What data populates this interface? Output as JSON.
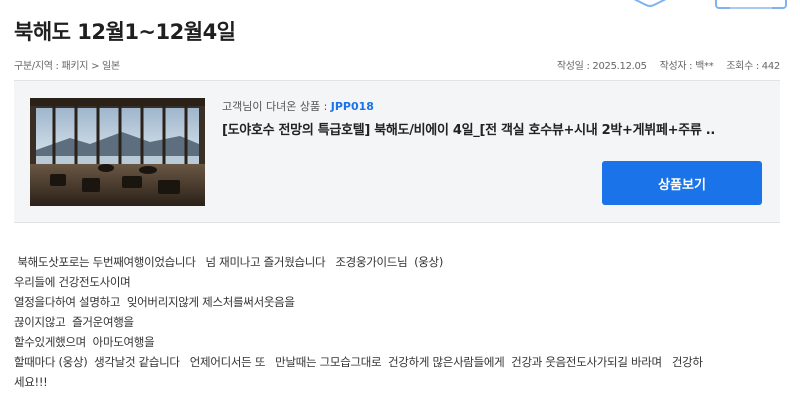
{
  "page": {
    "title": "북해도 12월1~12월4일",
    "breadcrumb": "구분/지역 : 패키지 > 일본",
    "meta": {
      "date": "작성일 : 2025.12.05",
      "author": "작성자 : 백**",
      "views": "조회수 : 442"
    }
  },
  "product": {
    "prefix": "고객님이 다녀온 상품 : ",
    "code": "JPP018",
    "name": "[도야호수 전망의 특급호텔] 북해도/비에이 4일_[전 객실 호수뷰+시내 2박+게뷔페+주류 ..",
    "button_label": "상품보기",
    "thumbnail_icon": "hotel-lake-photo"
  },
  "review": {
    "lines": [
      " 북해도삿포로는 두번째여행이었습니다   넘 재미나고 즐거웠습니다   조경웅가이드님  (웅상)",
      "우리들에 건강전도사이며",
      "열정을다하여 설명하고  잊어버리지않게 제스처를써서웃음을",
      "끊이지않고  즐거운여행을",
      "할수있게했으며  아마도여행을",
      "할때마다 (웅상)  생각날것 같습니다   언제어디서든 또   만날때는 그모습그대로  건강하게 많은사람들에게  건강과 웃음전도사가되길 바라며   건강하",
      "세요!!!"
    ]
  },
  "colors": {
    "accent": "#1a73e8",
    "box_bg": "#f4f5f7"
  }
}
